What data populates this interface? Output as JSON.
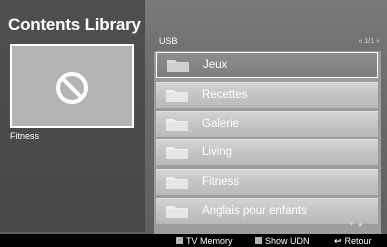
{
  "library": {
    "title": "Contents Library",
    "selected_item_label": "Fitness"
  },
  "device": {
    "name": "USB",
    "pager": "« 1/1 »"
  },
  "items": [
    {
      "label": "Jeux",
      "icon": "folder-icon",
      "selected": true
    },
    {
      "label": "Recettes",
      "icon": "folder-icon",
      "selected": false
    },
    {
      "label": "Galerie",
      "icon": "folder-icon",
      "selected": false
    },
    {
      "label": "Living",
      "icon": "folder-icon",
      "selected": false
    },
    {
      "label": "Fitness",
      "icon": "folder-icon",
      "selected": false
    },
    {
      "label": "Anglais pour enfants",
      "icon": "folder-icon",
      "selected": false
    }
  ],
  "scroll": {
    "arrows": "▼ ▲"
  },
  "footer": {
    "tv_memory": "TV Memory",
    "show_udn": "Show UDN",
    "return_label": "Retour",
    "return_icon": "return-icon"
  },
  "colors": {
    "folder": "#d9d9d9",
    "thumbnail": "#b3b3b3",
    "footer": "#000000"
  }
}
